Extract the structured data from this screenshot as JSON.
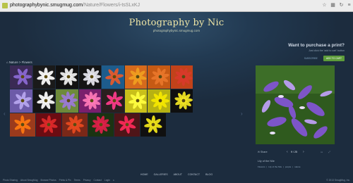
{
  "browser": {
    "url_host": "photographybynic.smugmug.com",
    "url_path": "/Nature/Flowers/i-tsSLxKJ"
  },
  "site": {
    "title": "Photography by Nic",
    "subtitle": "photographybynic.smugmug.com"
  },
  "purchase": {
    "question": "Want to purchase a print?",
    "detail": "Just click the 'add to cart' button",
    "subscribe_label": "SUBSCRIBE",
    "add_label": "ADD TO CART",
    "add_color": "#5d9c3a"
  },
  "breadcrumb": {
    "home_icon": "home-icon",
    "text": "Nature > Flowers"
  },
  "gallery": {
    "rows": [
      [
        "#3a2a55",
        "#1a1a1a",
        "#111111",
        "#141414",
        "#1d5c8c",
        "#d66a1c",
        "#c65a14",
        "#c2421a"
      ],
      [
        "#6c5aa8",
        "#151515",
        "#6e8a3a",
        "#7a1f6d",
        "#2a1f1f",
        "#c9c01a",
        "#b7b212",
        "#0f0f0f"
      ],
      [
        "#9b3a1c",
        "#6b0c12",
        "#7a2818",
        "#1b3312",
        "#4f1518",
        "#101010"
      ]
    ]
  },
  "nav": {
    "prev": "‹",
    "next": "›"
  },
  "viewer": {
    "share_label": "Share",
    "counter": "9 / 25",
    "caption": "Lily of the Nile",
    "keywords": [
      "Flowers",
      "Lily of the Nile",
      "purple",
      "nature"
    ],
    "prev_arrow": "‹",
    "next_arrow": "›"
  },
  "footnav": [
    "HOME",
    "GALLERIES",
    "ABOUT",
    "CONTACT",
    "BLOG"
  ],
  "footer": {
    "left": [
      "Photo Sharing",
      "About SmugMug",
      "Browse Photos",
      "Prints & Pix",
      "Terms",
      "Privacy",
      "Contact",
      "Login",
      "≤"
    ],
    "right": "© 2013 SmugMug, Inc."
  }
}
